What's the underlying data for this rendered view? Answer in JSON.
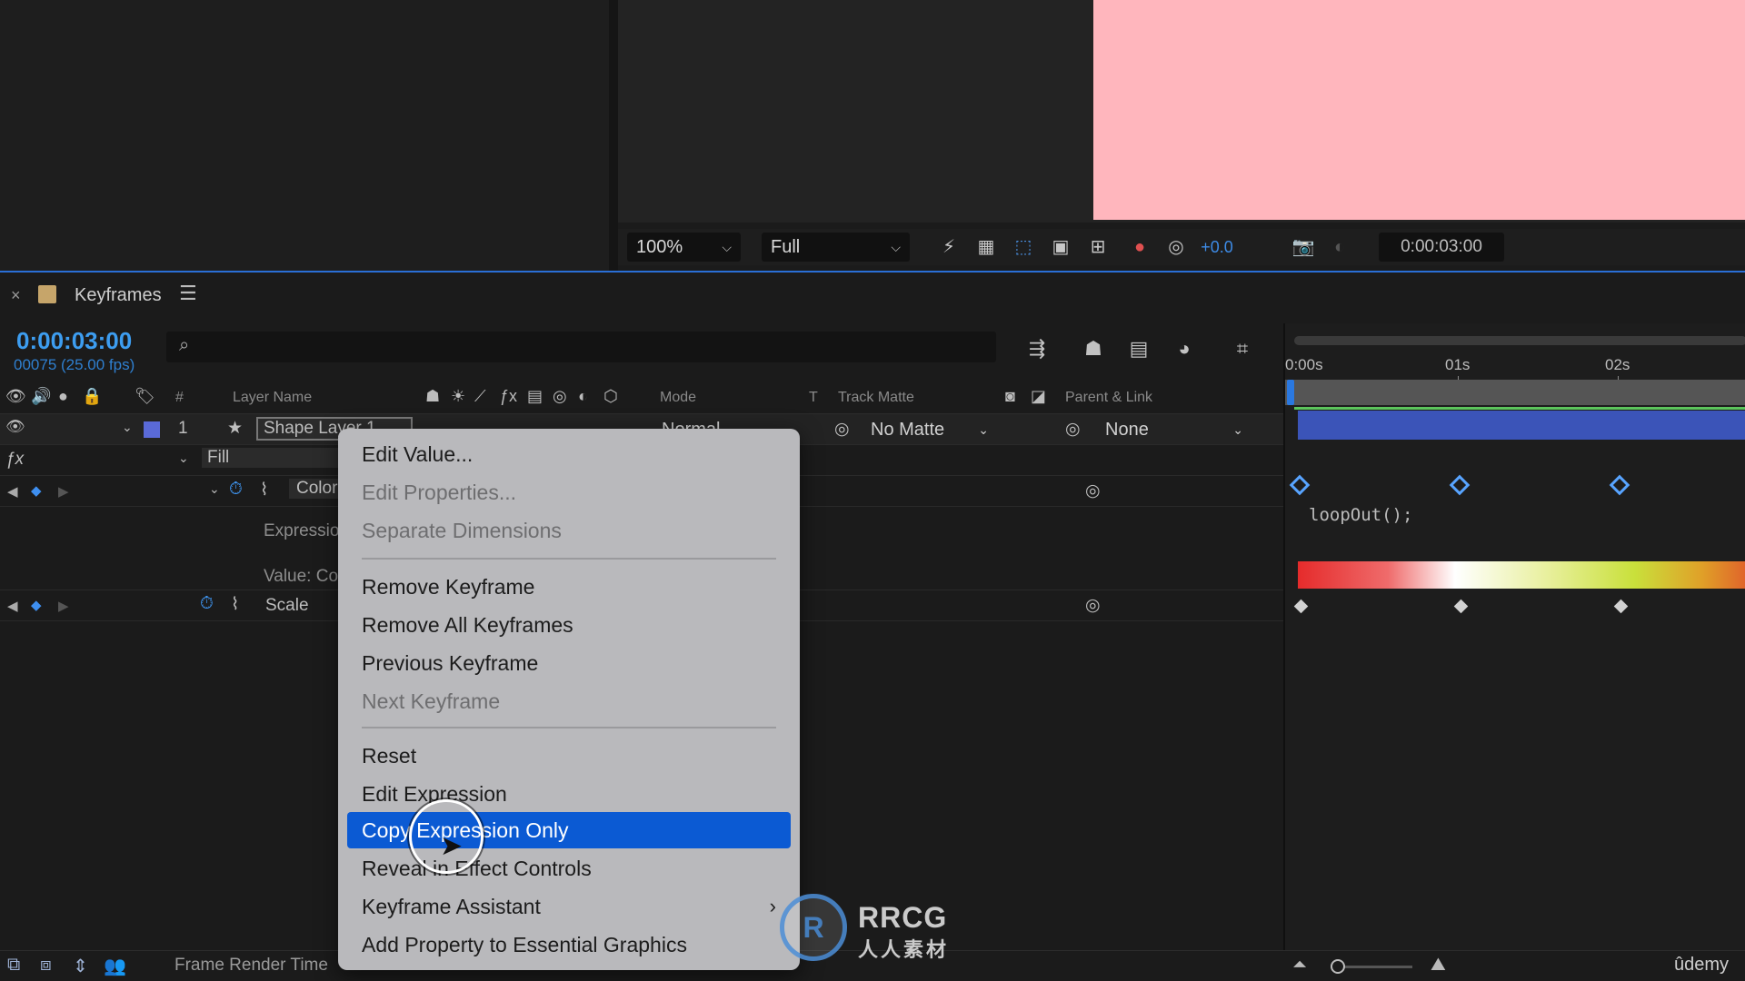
{
  "viewer": {
    "zoom": "100%",
    "resolution": "Full",
    "exposure": "+0.0",
    "timecode": "0:00:03:00",
    "canvas_color": "#ffb6bd"
  },
  "panel": {
    "tab_title": "Keyframes",
    "tab_swatch_color": "#c6a56a"
  },
  "timeline": {
    "timecode": "0:00:03:00",
    "frames": "00075 (25.00 fps)",
    "search_placeholder": ""
  },
  "columns": {
    "number": "#",
    "layer_name": "Layer Name",
    "mode": "Mode",
    "t": "T",
    "track_matte": "Track Matte",
    "parent_link": "Parent & Link"
  },
  "layer": {
    "index": "1",
    "name": "Shape Layer 1",
    "mode": "Normal",
    "track_matte": "No Matte",
    "parent": "None",
    "label_color": "#5a6ad8"
  },
  "properties": {
    "fill": "Fill",
    "color": "Color",
    "expression": "Expressio",
    "value": "Value: Co",
    "scale": "Scale"
  },
  "graph": {
    "ticks": [
      "0:00s",
      "01s",
      "02s"
    ],
    "expression_text": "loopOut();",
    "layer_bar_color": "#3b54b8"
  },
  "context_menu": {
    "items": [
      {
        "label": "Edit Value...",
        "disabled": false
      },
      {
        "label": "Edit Properties...",
        "disabled": true
      },
      {
        "label": "Separate Dimensions",
        "disabled": true
      },
      {
        "label": "Remove Keyframe",
        "disabled": false
      },
      {
        "label": "Remove All Keyframes",
        "disabled": false
      },
      {
        "label": "Previous Keyframe",
        "disabled": false
      },
      {
        "label": "Next Keyframe",
        "disabled": true
      },
      {
        "label": "Reset",
        "disabled": false
      },
      {
        "label": "Edit Expression",
        "disabled": false
      },
      {
        "label": "Copy Expression Only",
        "disabled": false,
        "selected": true
      },
      {
        "label": "Reveal in Effect Controls",
        "disabled": false
      },
      {
        "label": "Keyframe Assistant",
        "disabled": false,
        "submenu": true
      },
      {
        "label": "Add Property to Essential Graphics",
        "disabled": false
      }
    ],
    "selected_color": "#0b5ad3"
  },
  "bottom_bar": {
    "frame_render_time": "Frame Render Time"
  },
  "watermark": {
    "logo": "R",
    "brand": "RRCG",
    "sub": "人人素材",
    "udemy": "ûdemy"
  }
}
